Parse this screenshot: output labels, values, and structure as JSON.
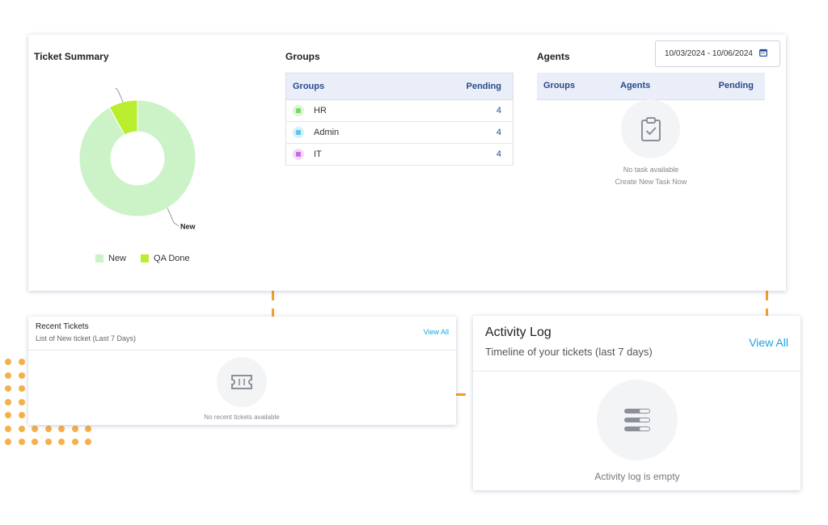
{
  "colors": {
    "new": "#ccf2c8",
    "qa_done": "#b9ee2e",
    "accent": "#1aa3e0",
    "header_text": "#2a4a8a",
    "dash": "#f0a030"
  },
  "ticket_summary": {
    "title": "Ticket Summary",
    "chart_data": {
      "type": "pie",
      "categories": [
        "New",
        "QA Done"
      ],
      "values": [
        92,
        8
      ],
      "slice_labels": [
        "New",
        "QA Done"
      ],
      "legend": [
        "New",
        "QA Done"
      ],
      "legend_placement": "bottom"
    }
  },
  "groups": {
    "title": "Groups",
    "headers": [
      "Groups",
      "Pending"
    ],
    "rows": [
      {
        "name": "HR",
        "pending": "4",
        "icon": "square-dot-icon",
        "color": "#7bd96a"
      },
      {
        "name": "Admin",
        "pending": "4",
        "icon": "square-dot-icon",
        "color": "#5bc3ef"
      },
      {
        "name": "IT",
        "pending": "4",
        "icon": "square-dot-icon",
        "color": "#c76ce8"
      }
    ]
  },
  "agents": {
    "title": "Agents",
    "headers": [
      "Groups",
      "Agents",
      "Pending"
    ],
    "empty_line1": "No task available",
    "empty_line2": "Create New Task Now",
    "icon": "clipboard-check-icon"
  },
  "date_range": {
    "value": "10/03/2024 - 10/06/2024",
    "icon": "calendar-icon"
  },
  "recent_tickets": {
    "title": "Recent Tickets",
    "subtitle": "List of New ticket (Last 7 Days)",
    "view_all": "View All",
    "empty": "No recent tickets available",
    "icon": "ticket-icon"
  },
  "activity_log": {
    "title": "Activity Log",
    "subtitle": "Timeline of your tickets (last 7 days)",
    "view_all": "View All",
    "empty": "Activity log is empty",
    "icon": "toggle-list-icon"
  }
}
